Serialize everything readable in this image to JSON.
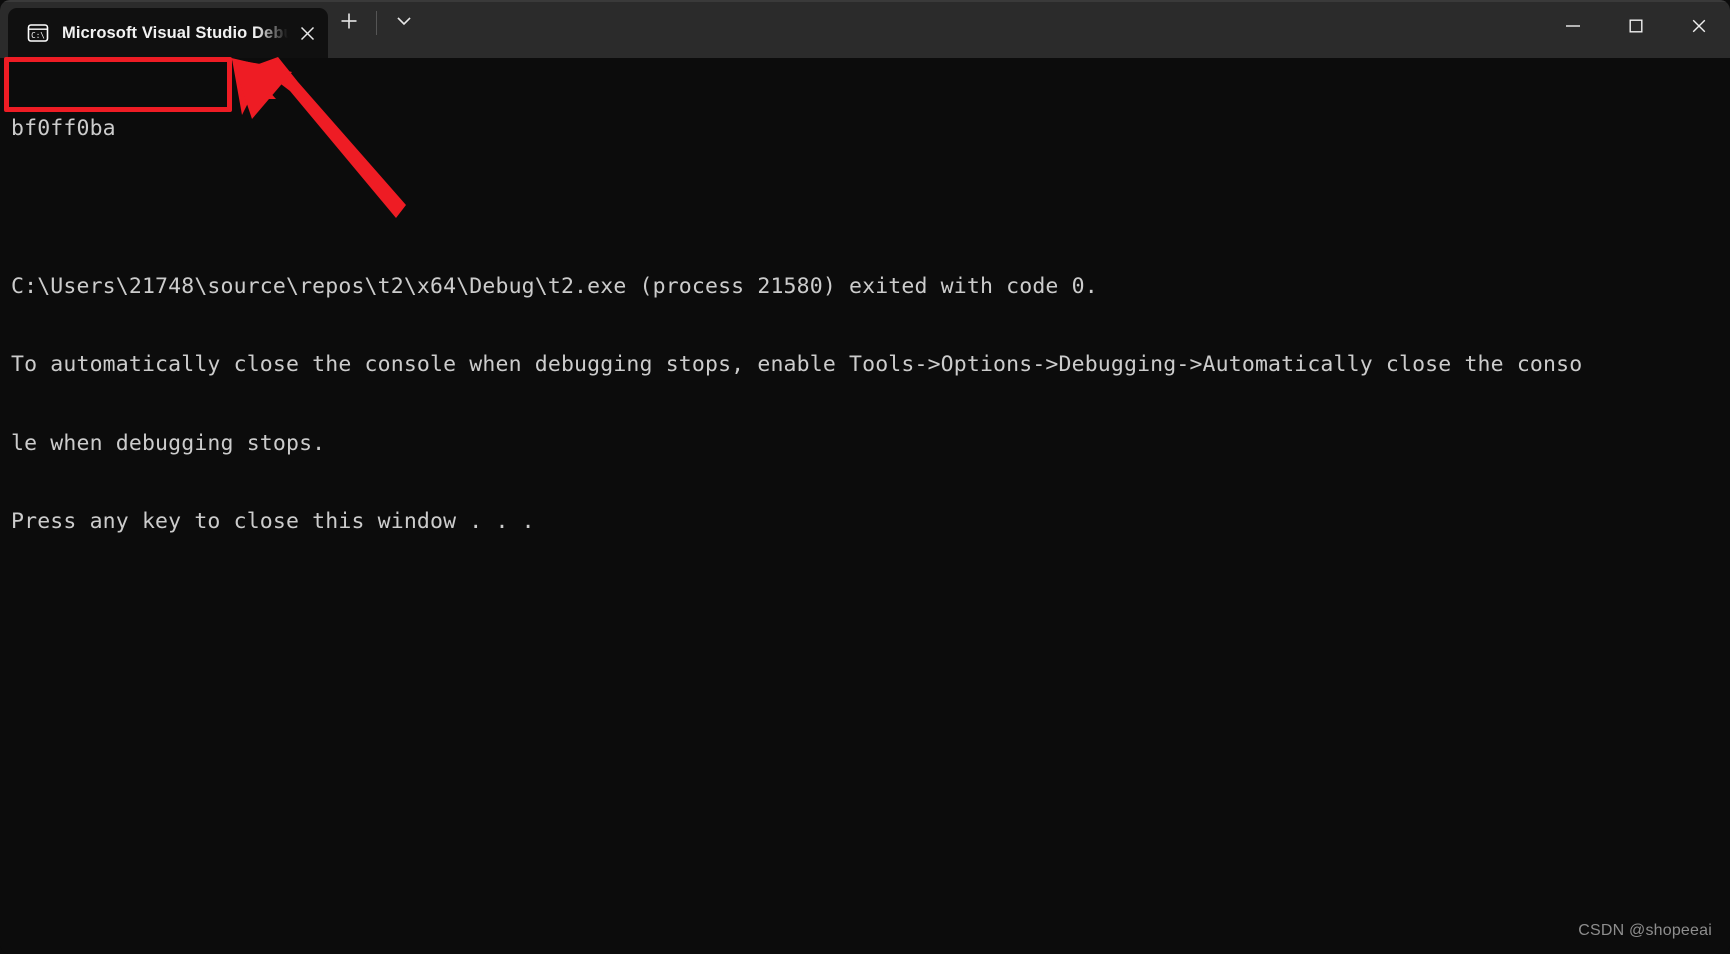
{
  "window": {
    "titlebar": {
      "tab": {
        "icon_name": "console-cmd-icon",
        "icon_label": "C:\\",
        "title": "Microsoft Visual Studio Debug",
        "close_label": "✕"
      },
      "new_tab_label": "+",
      "dropdown_label": "⌄",
      "controls": {
        "minimize_label": "—",
        "maximize_label": "□",
        "close_label": "✕"
      }
    },
    "console": {
      "background_color": "#0c0c0c",
      "foreground_color": "#cccccc",
      "lines": [
        "bf0ff0ba",
        "",
        "C:\\Users\\21748\\source\\repos\\t2\\x64\\Debug\\t2.exe (process 21580) exited with code 0.",
        "To automatically close the console when debugging stops, enable Tools->Options->Debugging->Automatically close the conso",
        "le when debugging stops.",
        "Press any key to close this window . . ."
      ]
    }
  },
  "annotations": {
    "highlight_box": {
      "color": "#ee1c24",
      "target_text": "bf0ff0ba"
    },
    "arrow": {
      "color": "#ee1c24",
      "direction": "up-left"
    }
  },
  "watermark": {
    "text": "CSDN @shopeeai"
  }
}
